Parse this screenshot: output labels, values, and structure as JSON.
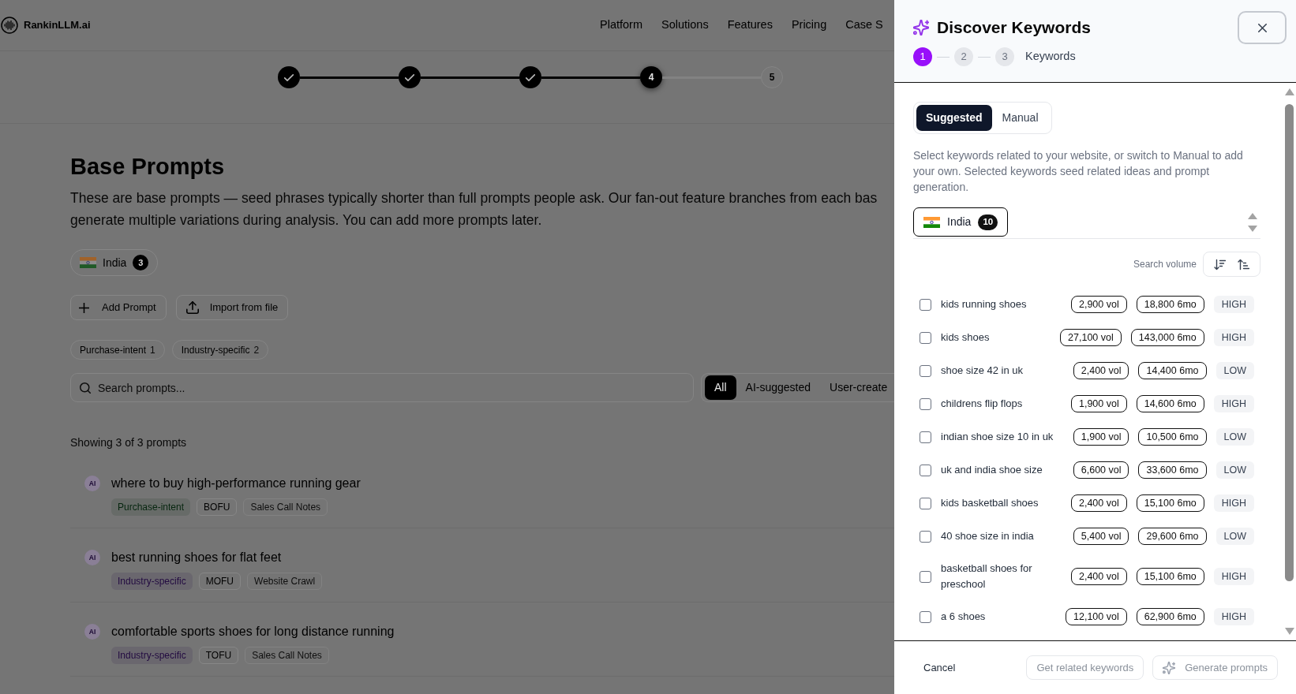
{
  "header": {
    "logo_text": "RankinLLM.ai",
    "nav": [
      "Platform",
      "Solutions",
      "Features",
      "Pricing",
      "Case S"
    ]
  },
  "progress_steps": [
    {
      "completed": true,
      "selected": false
    },
    {
      "completed": true,
      "selected": false
    },
    {
      "completed": true,
      "selected": false
    },
    {
      "number": "4",
      "completed": false,
      "selected": true
    },
    {
      "number": "5",
      "completed": false,
      "selected": false
    }
  ],
  "page": {
    "title": "Base Prompts",
    "description_lines": [
      "These are base prompts — seed phrases typically shorter than full prompts people ask. Our fan-out feature branches from each bas",
      "generate multiple variations during analysis. You can add more prompts later."
    ],
    "country": {
      "label": "India",
      "count": "3"
    },
    "actions": [
      {
        "kind": "add",
        "label": "Add Prompt"
      },
      {
        "kind": "import",
        "label": "Import from file"
      }
    ],
    "tag_filters": [
      {
        "label": "Purchase-intent",
        "count": "1"
      },
      {
        "label": "Industry-specific",
        "count": "2"
      }
    ],
    "search": {
      "placeholder": "Search prompts..."
    },
    "source_filters": [
      {
        "label": "All",
        "selected": true
      },
      {
        "label": "AI-suggested",
        "selected": false
      },
      {
        "label": "User-create",
        "selected": false
      }
    ],
    "results_summary": "Showing 3 of 3 prompts",
    "prompts": [
      {
        "badge": "AI",
        "text": "where to buy high-performance running gear",
        "tags": [
          {
            "kind": "intent",
            "label": "Purchase-intent",
            "color": "#06260f"
          },
          {
            "kind": "stage",
            "label": "BOFU"
          },
          {
            "kind": "source",
            "label": "Sales Call Notes"
          }
        ]
      },
      {
        "badge": "AI",
        "text": "best running shoes for flat feet",
        "tags": [
          {
            "kind": "intent",
            "label": "Industry-specific",
            "color": "#220a40"
          },
          {
            "kind": "stage",
            "label": "MOFU"
          },
          {
            "kind": "source",
            "label": "Website Crawl"
          }
        ]
      },
      {
        "badge": "AI",
        "text": "comfortable sports shoes for long distance running",
        "tags": [
          {
            "kind": "intent",
            "label": "Industry-specific",
            "color": "#220a40"
          },
          {
            "kind": "stage",
            "label": "TOFU"
          },
          {
            "kind": "source",
            "label": "Sales Call Notes"
          }
        ]
      }
    ]
  },
  "panel": {
    "title": "Discover Keywords",
    "steps": [
      {
        "number": "1",
        "selected": true
      },
      {
        "number": "2",
        "selected": false
      },
      {
        "number": "3",
        "selected": false
      }
    ],
    "step_label": "Keywords",
    "tabs": [
      {
        "label": "Suggested",
        "selected": true
      },
      {
        "label": "Manual",
        "selected": false
      }
    ],
    "description": "Select keywords related to your website, or switch to Manual to add your own. Selected keywords seed related ideas and prompt generation.",
    "countries": [
      {
        "label": "India",
        "count": "10",
        "selected": true
      }
    ],
    "sort_label": "Search volume",
    "keywords": [
      {
        "keyword": "kids running shoes",
        "checked": false,
        "volume": "2,900 vol",
        "six_month": "18,800 6mo",
        "competition": "HIGH"
      },
      {
        "keyword": "kids shoes",
        "checked": false,
        "volume": "27,100 vol",
        "six_month": "143,000 6mo",
        "competition": "HIGH"
      },
      {
        "keyword": "shoe size 42 in uk",
        "checked": false,
        "volume": "2,400 vol",
        "six_month": "14,400 6mo",
        "competition": "LOW"
      },
      {
        "keyword": "childrens flip flops",
        "checked": false,
        "volume": "1,900 vol",
        "six_month": "14,600 6mo",
        "competition": "HIGH"
      },
      {
        "keyword": "indian shoe size 10 in uk",
        "checked": false,
        "volume": "1,900 vol",
        "six_month": "10,500 6mo",
        "competition": "LOW"
      },
      {
        "keyword": "uk and india shoe size",
        "checked": false,
        "volume": "6,600 vol",
        "six_month": "33,600 6mo",
        "competition": "LOW"
      },
      {
        "keyword": "kids basketball shoes",
        "checked": false,
        "volume": "2,400 vol",
        "six_month": "15,100 6mo",
        "competition": "HIGH"
      },
      {
        "keyword": "40 shoe size in india",
        "checked": false,
        "volume": "5,400 vol",
        "six_month": "29,600 6mo",
        "competition": "LOW"
      },
      {
        "keyword": "basketball shoes for preschool",
        "checked": false,
        "volume": "2,400 vol",
        "six_month": "15,100 6mo",
        "competition": "HIGH"
      },
      {
        "keyword": "a 6 shoes",
        "checked": false,
        "volume": "12,100 vol",
        "six_month": "62,900 6mo",
        "competition": "HIGH"
      }
    ],
    "footer": {
      "cancel": "Cancel",
      "actions": [
        {
          "kind": "related",
          "label": "Get related keywords",
          "disabled": true
        },
        {
          "kind": "generate",
          "label": "Generate prompts",
          "disabled": true
        }
      ]
    }
  }
}
